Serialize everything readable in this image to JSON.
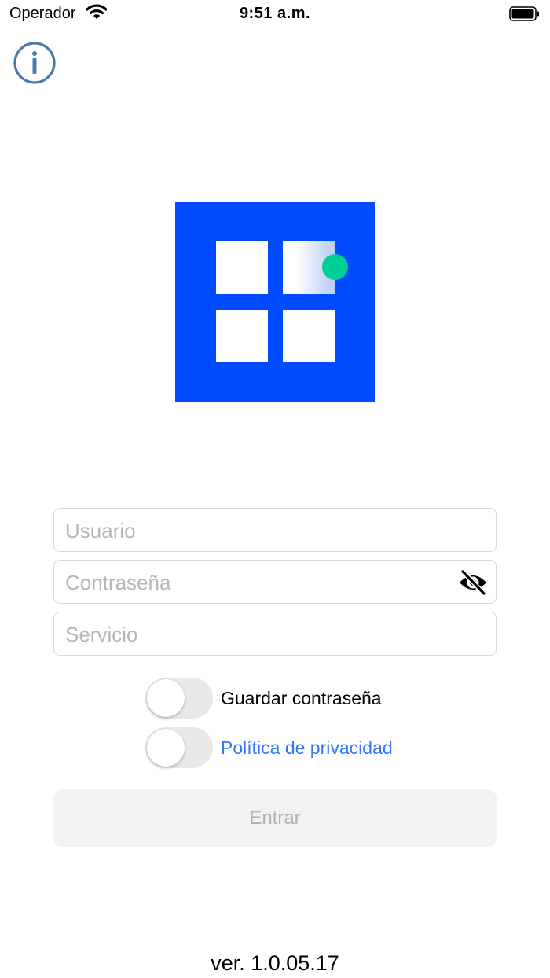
{
  "status_bar": {
    "carrier": "Operador",
    "time": "9:51 a.m.",
    "icons": [
      "wifi-icon",
      "battery-icon"
    ]
  },
  "header": {
    "info_icon": "info-circle-icon"
  },
  "logo": {
    "colors": {
      "background": "#004bff",
      "tile": "#ffffff",
      "dot": "#00cf95"
    }
  },
  "form": {
    "username": {
      "placeholder": "Usuario",
      "value": ""
    },
    "password": {
      "placeholder": "Contraseña",
      "value": "",
      "toggle_icon": "eye-slash-icon"
    },
    "service": {
      "placeholder": "Servicio",
      "value": ""
    }
  },
  "options": {
    "save_password": {
      "label": "Guardar contraseña",
      "on": false
    },
    "privacy_policy": {
      "label": "Política de privacidad",
      "on": false
    }
  },
  "login_button": {
    "label": "Entrar",
    "enabled": false
  },
  "footer": {
    "version": "ver. 1.0.05.17"
  },
  "colors": {
    "link": "#3478f6",
    "disabled_text": "#b3b3b3",
    "info_icon": "#4a7aa8"
  }
}
